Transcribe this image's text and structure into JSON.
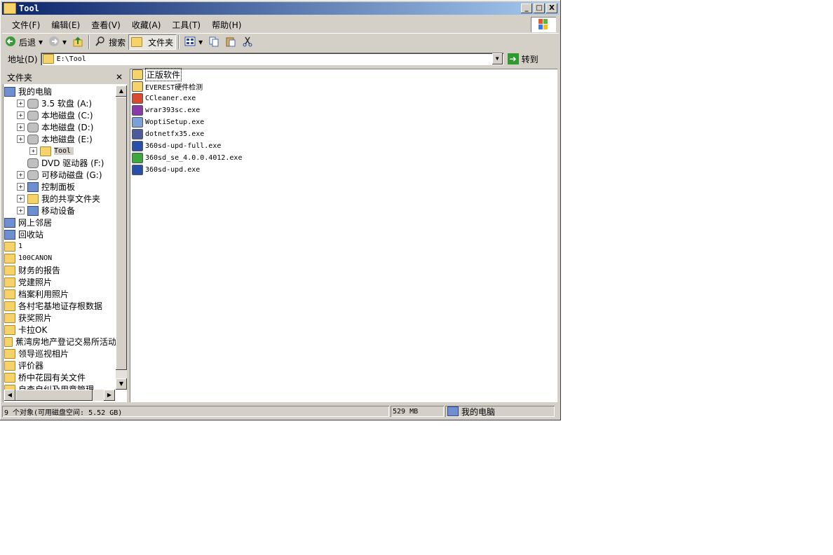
{
  "window": {
    "title": "Tool",
    "controls": [
      "_",
      "□",
      "X"
    ]
  },
  "menu": [
    "文件(F)",
    "编辑(E)",
    "查看(V)",
    "收藏(A)",
    "工具(T)",
    "帮助(H)"
  ],
  "toolbar": {
    "back": "后退",
    "search": "搜索",
    "folders": "文件夹"
  },
  "address": {
    "label": "地址(D)",
    "value": "E:\\Tool",
    "go": "转到"
  },
  "folder_pane": {
    "title": "文件夹",
    "items": [
      {
        "label": "我的电脑",
        "level": 0,
        "icon": "computer-icon"
      },
      {
        "label": "3.5 软盘 (A:)",
        "level": 1,
        "icon": "floppy-icon",
        "expander": "+"
      },
      {
        "label": "本地磁盘 (C:)",
        "level": 1,
        "icon": "drive-icon",
        "expander": "+"
      },
      {
        "label": "本地磁盘 (D:)",
        "level": 1,
        "icon": "drive-icon",
        "expander": "+"
      },
      {
        "label": "本地磁盘 (E:)",
        "level": 1,
        "icon": "drive-icon",
        "expander": "+"
      },
      {
        "label": "Tool",
        "level": 2,
        "icon": "folder-icon",
        "expander": "+",
        "selected": true
      },
      {
        "label": "DVD 驱动器 (F:)",
        "level": 1,
        "icon": "dvd-icon"
      },
      {
        "label": "可移动磁盘 (G:)",
        "level": 1,
        "icon": "removable-drive-icon",
        "expander": "+"
      },
      {
        "label": "控制面板",
        "level": 1,
        "icon": "control-panel-icon",
        "expander": "+"
      },
      {
        "label": "我的共享文件夹",
        "level": 1,
        "icon": "shared-folder-icon",
        "expander": "+"
      },
      {
        "label": "移动设备",
        "level": 1,
        "icon": "mobile-device-icon",
        "expander": "+"
      },
      {
        "label": "网上邻居",
        "level": 0,
        "icon": "network-icon"
      },
      {
        "label": "回收站",
        "level": 0,
        "icon": "recycle-bin-icon"
      },
      {
        "label": "1",
        "level": 0,
        "icon": "folder-icon"
      },
      {
        "label": "100CANON",
        "level": 0,
        "icon": "folder-icon"
      },
      {
        "label": "财务的报告",
        "level": 0,
        "icon": "folder-icon"
      },
      {
        "label": "党建照片",
        "level": 0,
        "icon": "folder-icon"
      },
      {
        "label": "档案利用照片",
        "level": 0,
        "icon": "folder-icon"
      },
      {
        "label": "各村宅基地证存根数据",
        "level": 0,
        "icon": "folder-icon"
      },
      {
        "label": "获奖照片",
        "level": 0,
        "icon": "folder-icon"
      },
      {
        "label": "卡拉OK",
        "level": 0,
        "icon": "folder-icon"
      },
      {
        "label": "蕉湾房地产登记交易所活动",
        "level": 0,
        "icon": "folder-icon"
      },
      {
        "label": "领导巡视相片",
        "level": 0,
        "icon": "folder-icon"
      },
      {
        "label": "评价器",
        "level": 0,
        "icon": "folder-icon"
      },
      {
        "label": "桥中花园有关文件",
        "level": 0,
        "icon": "folder-icon"
      },
      {
        "label": "自查自纠及用章管理",
        "level": 0,
        "icon": "folder-icon"
      }
    ]
  },
  "files": [
    {
      "name": "正版软件",
      "icon": "folder-icon",
      "color": "#f6d36a",
      "selected": true
    },
    {
      "name": "EVEREST硬件检测",
      "icon": "folder-icon",
      "color": "#f6d36a"
    },
    {
      "name": "CCleaner.exe",
      "icon": "ccleaner-icon",
      "color": "#d94a2e"
    },
    {
      "name": "wrar393sc.exe",
      "icon": "winrar-icon",
      "color": "#8a3aa8"
    },
    {
      "name": "WoptiSetup.exe",
      "icon": "setup-icon",
      "color": "#7aa0d8"
    },
    {
      "name": "dotnetfx35.exe",
      "icon": "setup-icon",
      "color": "#4a5a9a"
    },
    {
      "name": "360sd-upd-full.exe",
      "icon": "360-update-icon",
      "color": "#2850a8"
    },
    {
      "name": "360sd_se_4.0.0.4012.exe",
      "icon": "360-icon",
      "color": "#3da83d"
    },
    {
      "name": "360sd-upd.exe",
      "icon": "360-update-icon",
      "color": "#2850a8"
    }
  ],
  "status": {
    "objects": "9 个对象(可用磁盘空间: 5.52 GB)",
    "size": "529 MB",
    "location": "我的电脑"
  }
}
